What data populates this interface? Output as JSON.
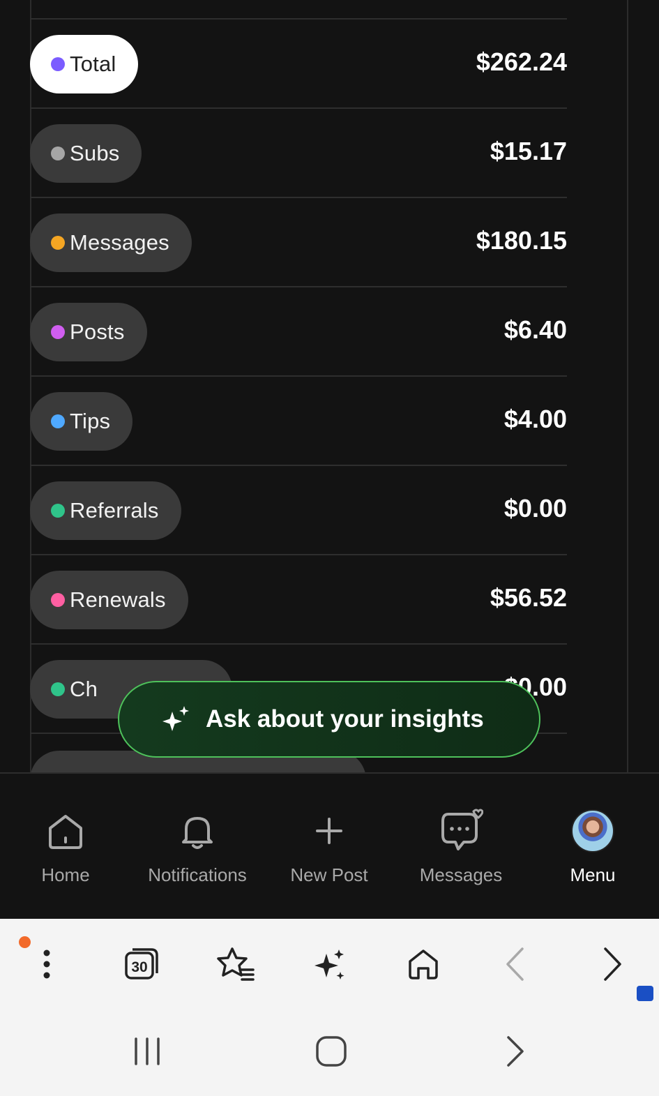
{
  "earnings": [
    {
      "label": "Total",
      "amount": "$262.24",
      "dot_color": "#7b5cff",
      "active": true
    },
    {
      "label": "Subs",
      "amount": "$15.17",
      "dot_color": "#a6a6a6"
    },
    {
      "label": "Messages",
      "amount": "$180.15",
      "dot_color": "#f5a623"
    },
    {
      "label": "Posts",
      "amount": "$6.40",
      "dot_color": "#d05ef0"
    },
    {
      "label": "Tips",
      "amount": "$4.00",
      "dot_color": "#4fa9ff"
    },
    {
      "label": "Referrals",
      "amount": "$0.00",
      "dot_color": "#2fc48a"
    },
    {
      "label": "Renewals",
      "amount": "$56.52",
      "dot_color": "#ff5fa2"
    },
    {
      "label": "Ch",
      "amount": "$0.00",
      "dot_color": "#2fc48a"
    }
  ],
  "ask_button": {
    "label": "Ask about your insights",
    "border_color": "#4ec25b"
  },
  "bottom_nav": {
    "home": "Home",
    "notifications": "Notifications",
    "new_post": "New Post",
    "messages": "Messages",
    "menu": "Menu"
  },
  "browser_toolbar": {
    "tabs_count": "30",
    "icons": [
      "more-vertical-icon",
      "tabs-icon",
      "bookmarks-icon",
      "ai-sparkle-icon",
      "home-icon",
      "back-icon",
      "forward-icon"
    ]
  }
}
